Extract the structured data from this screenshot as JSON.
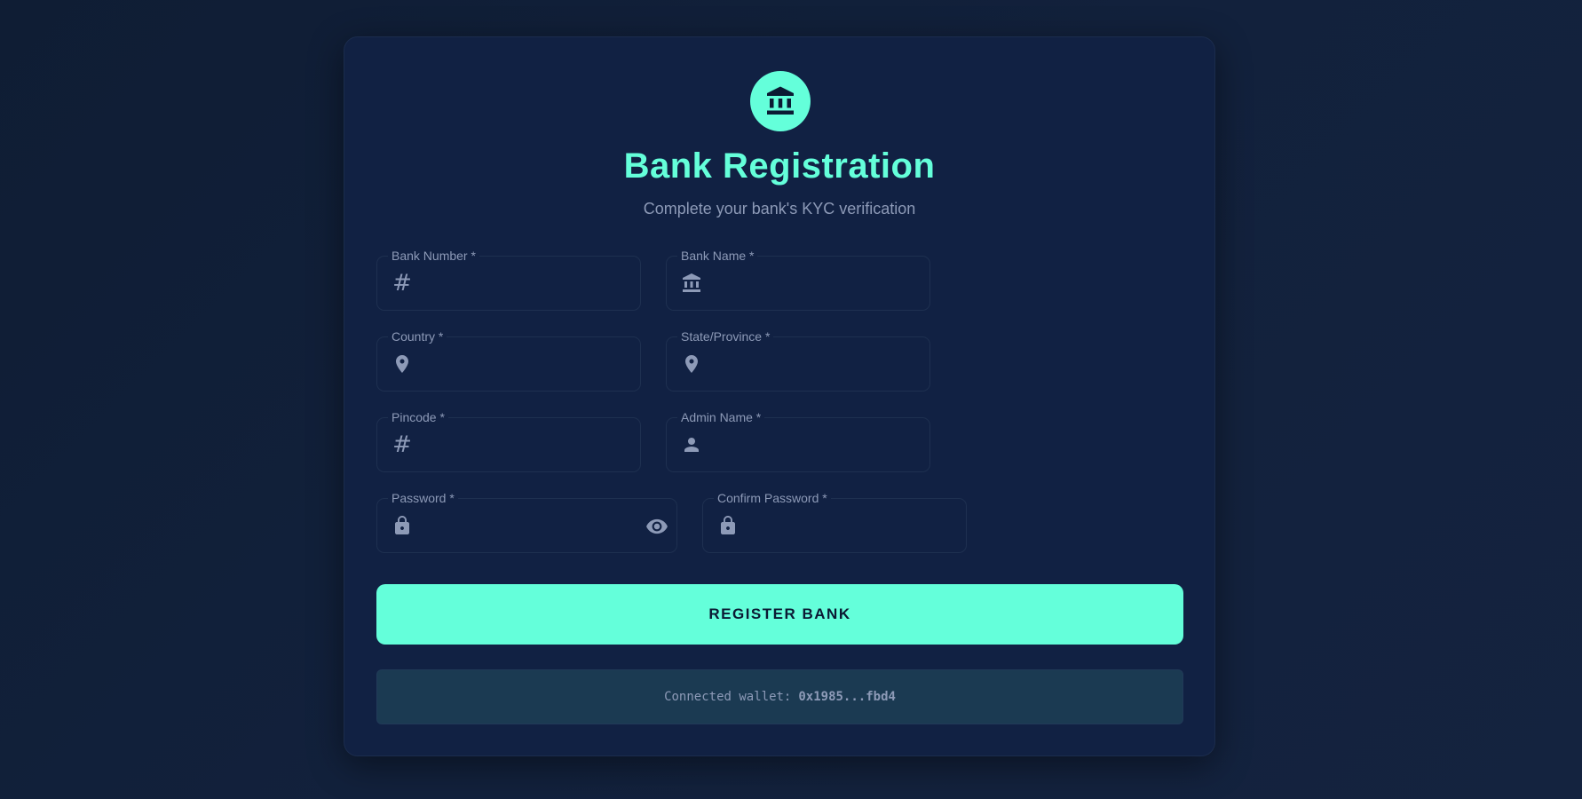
{
  "header": {
    "icon": "bank-icon",
    "title": "Bank Registration",
    "subtitle": "Complete your bank's KYC verification"
  },
  "form": {
    "bank_number": {
      "label": "Bank Number *",
      "icon": "hash-icon",
      "value": ""
    },
    "bank_name": {
      "label": "Bank Name *",
      "icon": "bank-icon",
      "value": ""
    },
    "country": {
      "label": "Country *",
      "icon": "location-pin-icon",
      "value": ""
    },
    "state": {
      "label": "State/Province *",
      "icon": "location-pin-icon",
      "value": ""
    },
    "pincode": {
      "label": "Pincode *",
      "icon": "hash-icon",
      "value": ""
    },
    "admin_name": {
      "label": "Admin Name *",
      "icon": "person-icon",
      "value": ""
    },
    "password": {
      "label": "Password *",
      "icon": "lock-icon",
      "toggle_icon": "eye-icon",
      "value": ""
    },
    "confirm_password": {
      "label": "Confirm Password *",
      "icon": "lock-icon",
      "value": ""
    }
  },
  "register_button": {
    "label": "REGISTER BANK"
  },
  "wallet": {
    "prefix": "Connected wallet:",
    "address": "0x1985...fbd4"
  },
  "colors": {
    "accent": "#64ffda",
    "card_background": "#112143",
    "page_background": "#0f1d34",
    "muted_text": "#8d9ab7",
    "wallet_background": "#1b3a52"
  }
}
